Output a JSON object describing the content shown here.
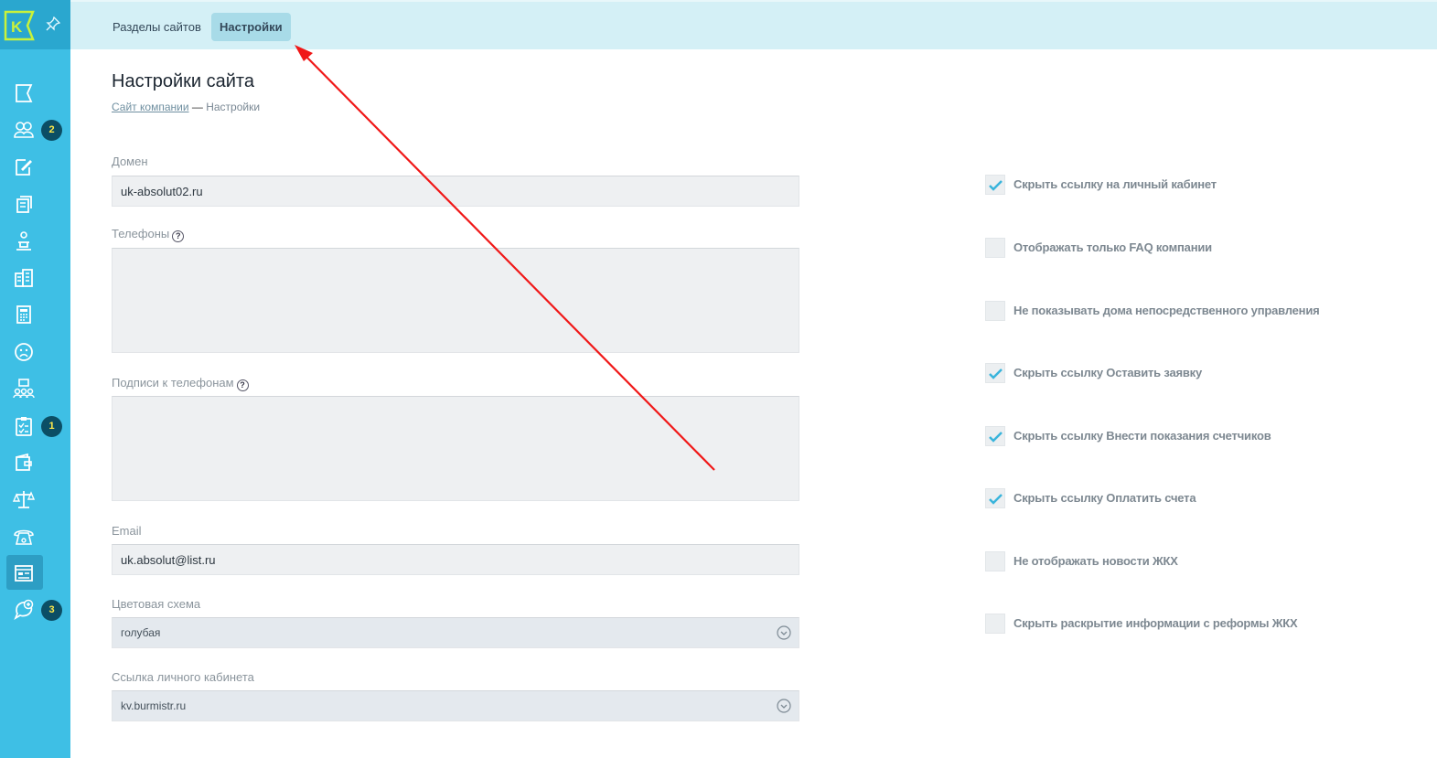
{
  "app": {
    "logo_letter": "K",
    "brand_color": "#3ebfe5",
    "badge_color": "#0b4e65",
    "badge_text_color": "#ffe94a"
  },
  "sidebar": {
    "items": [
      {
        "icon": "flag-icon",
        "badge": null
      },
      {
        "icon": "users-icon",
        "badge": "2"
      },
      {
        "icon": "edit-icon",
        "badge": null
      },
      {
        "icon": "documents-icon",
        "badge": null
      },
      {
        "icon": "worker-icon",
        "badge": null
      },
      {
        "icon": "buildings-icon",
        "badge": null
      },
      {
        "icon": "calculator-icon",
        "badge": null
      },
      {
        "icon": "sad-face-icon",
        "badge": null
      },
      {
        "icon": "people-group-icon",
        "badge": null
      },
      {
        "icon": "checklist-icon",
        "badge": "1"
      },
      {
        "icon": "wallet-icon",
        "badge": null
      },
      {
        "icon": "scales-icon",
        "badge": null
      },
      {
        "icon": "phone-icon",
        "badge": null
      },
      {
        "icon": "site-icon",
        "badge": null,
        "active": true
      },
      {
        "icon": "chat-plus-icon",
        "badge": "3"
      }
    ]
  },
  "topbar": {
    "tabs": [
      {
        "label": "Разделы сайтов",
        "active": false
      },
      {
        "label": "Настройки",
        "active": true
      }
    ]
  },
  "page": {
    "title": "Настройки сайта",
    "breadcrumb": {
      "link": "Сайт компании",
      "separator": "—",
      "current": "Настройки"
    }
  },
  "form": {
    "domain": {
      "label": "Домен",
      "value": "uk-absolut02.ru"
    },
    "phones": {
      "label": "Телефоны",
      "value": ""
    },
    "phone_captions": {
      "label": "Подписи к телефонам",
      "value": ""
    },
    "email": {
      "label": "Email",
      "value": "uk.absolut@list.ru"
    },
    "color_scheme": {
      "label": "Цветовая схема",
      "value": "голубая"
    },
    "cabinet_link": {
      "label": "Ссылка личного кабинета",
      "value": "kv.burmistr.ru"
    },
    "help_glyph": "?"
  },
  "options": [
    {
      "label": "Скрыть ссылку на личный кабинет",
      "checked": true
    },
    {
      "label": "Отображать только FAQ компании",
      "checked": false
    },
    {
      "label": "Не показывать дома непосредственного управления",
      "checked": false
    },
    {
      "label": "Скрыть ссылку Оставить заявку",
      "checked": true
    },
    {
      "label": "Скрыть ссылку Внести показания счетчиков",
      "checked": true
    },
    {
      "label": "Скрыть ссылку Оплатить счета",
      "checked": true
    },
    {
      "label": "Не отображать новости ЖКХ",
      "checked": false
    },
    {
      "label": "Скрыть раскрытие информации с реформы ЖКХ",
      "checked": false
    }
  ]
}
